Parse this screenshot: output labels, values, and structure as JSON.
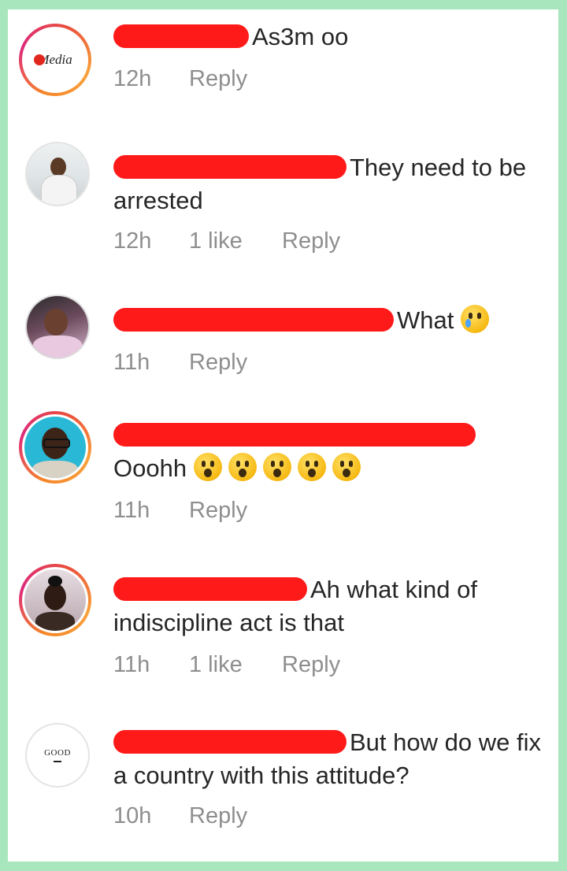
{
  "comments": [
    {
      "text": "As3m oo",
      "time": "12h",
      "likes": "",
      "reply": "Reply",
      "avatar_label": "Media"
    },
    {
      "text": "They need to be arrested",
      "time": "12h",
      "likes": "1 like",
      "reply": "Reply"
    },
    {
      "text": "What",
      "time": "11h",
      "likes": "",
      "reply": "Reply"
    },
    {
      "text": "Ooohh",
      "time": "11h",
      "likes": "",
      "reply": "Reply"
    },
    {
      "text": "Ah what kind of indiscipline act is that",
      "time": "11h",
      "likes": "1 like",
      "reply": "Reply"
    },
    {
      "text": "But how do we fix a country with this attitude?",
      "time": "10h",
      "likes": "",
      "reply": "Reply",
      "avatar_label": "GOOD"
    }
  ],
  "colors": {
    "border": "#a8e6bd",
    "redaction": "#ff1a1a",
    "text": "#262626",
    "meta": "#8e8e8e"
  }
}
